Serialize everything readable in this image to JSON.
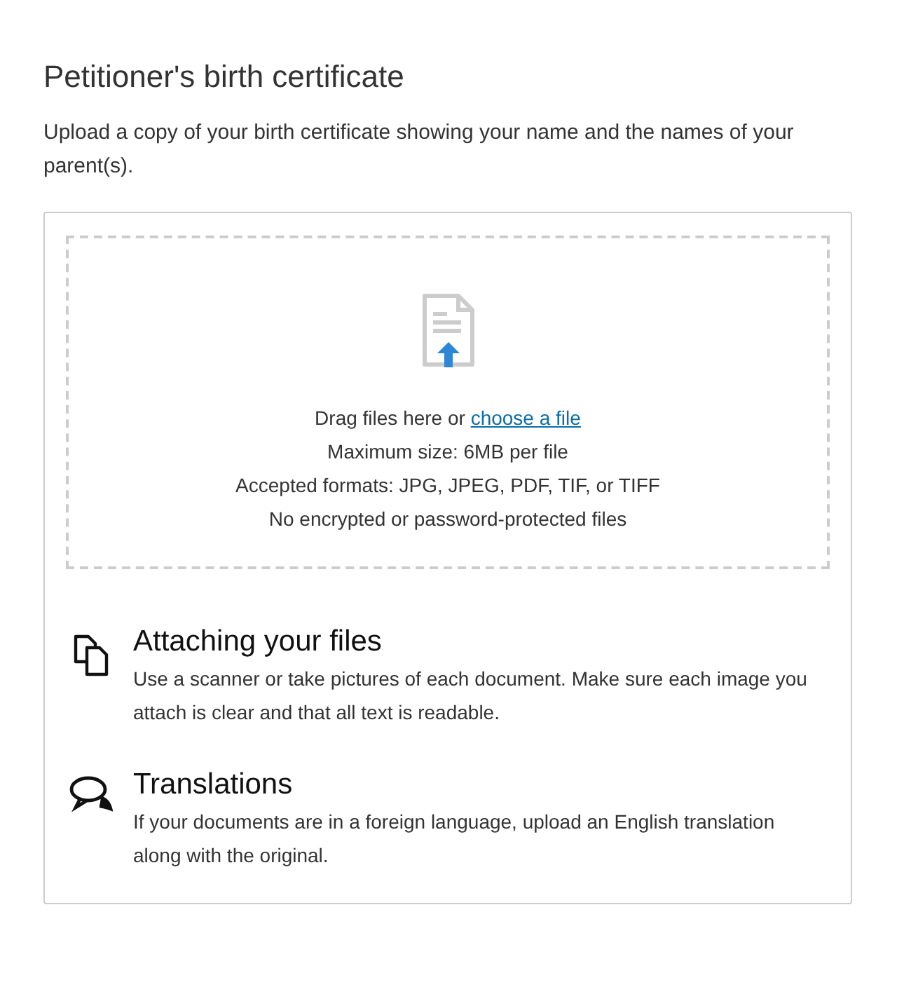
{
  "title": "Petitioner's birth certificate",
  "description": "Upload a copy of your birth certificate showing your name and the names of your parent(s).",
  "dropzone": {
    "prompt": "Drag files here or",
    "link": "choose a file",
    "lines": [
      "Maximum size: 6MB per file",
      "Accepted formats: JPG, JPEG, PDF, TIF, or TIFF",
      "No encrypted or password-protected files"
    ]
  },
  "tips": [
    {
      "kind": "files",
      "title": "Attaching your files",
      "text": "Use a scanner or take pictures of each document. Make sure each image you attach is clear and that all text is readable."
    },
    {
      "kind": "translation",
      "title": "Translations",
      "text": "If your documents are in a foreign language, upload an English translation along with the original."
    }
  ]
}
